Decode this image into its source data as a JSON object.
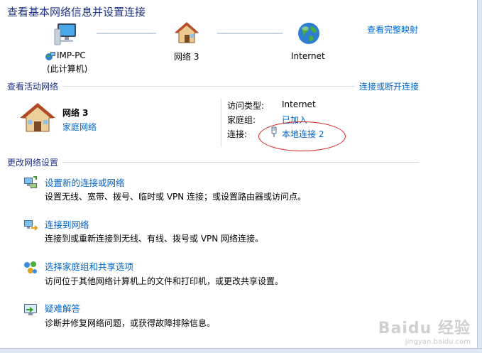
{
  "header": {
    "title": "查看基本网络信息并设置连接",
    "view_full_map": "查看完整映射"
  },
  "map": {
    "computer_name": "IMP-PC",
    "computer_sub": "(此计算机)",
    "network_name": "网络 3",
    "internet_label": "Internet"
  },
  "active": {
    "section_title": "查看活动网络",
    "connect_disconnect": "连接或断开连接",
    "network_name": "网络 3",
    "network_type": "家庭网络",
    "access_type_label": "访问类型:",
    "access_type_value": "Internet",
    "homegroup_label": "家庭组:",
    "homegroup_value": "已加入",
    "connection_label": "连接:",
    "connection_value": "本地连接 2"
  },
  "change": {
    "section_title": "更改网络设置",
    "tasks": [
      {
        "title": "设置新的连接或网络",
        "desc": "设置无线、宽带、拨号、临时或 VPN 连接；或设置路由器或访问点。",
        "icon": "network-setup-icon"
      },
      {
        "title": "连接到网络",
        "desc": "连接到或重新连接到无线、有线、拨号或 VPN 网络连接。",
        "icon": "connect-network-icon"
      },
      {
        "title": "选择家庭组和共享选项",
        "desc": "访问位于其他网络计算机上的文件和打印机，或更改共享设置。",
        "icon": "homegroup-icon"
      },
      {
        "title": "疑难解答",
        "desc": "诊断并修复网络问题，或获得故障排除信息。",
        "icon": "troubleshoot-icon"
      }
    ]
  },
  "watermark": {
    "brand": "Baidu 经验",
    "url": "jingyan.baidu.com"
  },
  "colors": {
    "title": "#1e3287",
    "link": "#0066cc",
    "annotation": "#d21f1f"
  }
}
